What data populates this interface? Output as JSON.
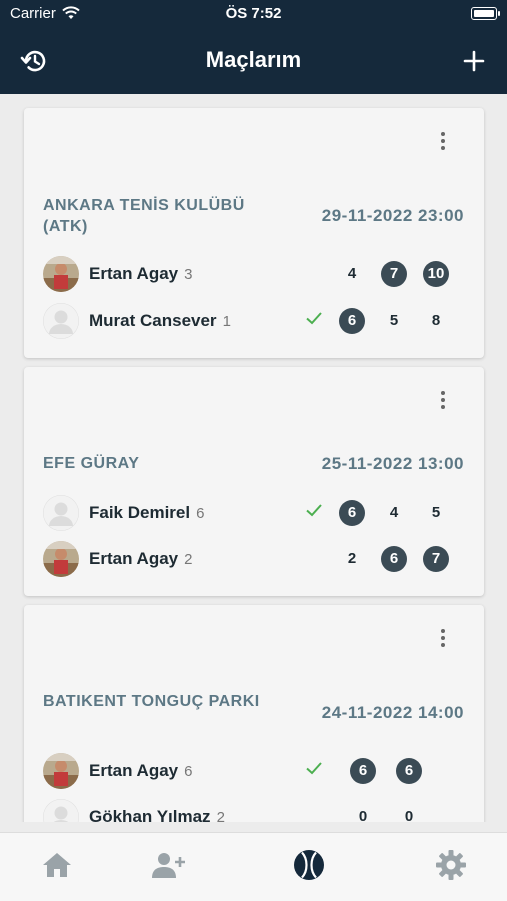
{
  "status_bar": {
    "carrier": "Carrier",
    "time": "ÖS 7:52"
  },
  "header": {
    "title": "Maçlarım",
    "left_icon": "history-icon",
    "right_icon": "plus-icon"
  },
  "matches": [
    {
      "club": "ANKARA TENİS KULÜBÜ (ATK)",
      "date": "29-11-2022 23:00",
      "players": [
        {
          "name": "Ertan Agay",
          "rank": "3",
          "winner": false,
          "avatar": "photo",
          "scores": [
            {
              "value": "4",
              "won": false
            },
            {
              "value": "7",
              "won": true
            },
            {
              "value": "10",
              "won": true
            }
          ]
        },
        {
          "name": "Murat Cansever",
          "rank": "1",
          "winner": true,
          "avatar": "placeholder",
          "scores": [
            {
              "value": "6",
              "won": true
            },
            {
              "value": "5",
              "won": false
            },
            {
              "value": "8",
              "won": false
            }
          ]
        }
      ]
    },
    {
      "club": "EFE GÜRAY",
      "date": "25-11-2022 13:00",
      "players": [
        {
          "name": "Faik Demirel",
          "rank": "6",
          "winner": true,
          "avatar": "placeholder",
          "scores": [
            {
              "value": "6",
              "won": true
            },
            {
              "value": "4",
              "won": false
            },
            {
              "value": "5",
              "won": false
            }
          ]
        },
        {
          "name": "Ertan Agay",
          "rank": "2",
          "winner": false,
          "avatar": "photo",
          "scores": [
            {
              "value": "2",
              "won": false
            },
            {
              "value": "6",
              "won": true
            },
            {
              "value": "7",
              "won": true
            }
          ]
        }
      ]
    },
    {
      "club": "BATIKENT TONGUÇ PARKI",
      "date": "24-11-2022 14:00",
      "players": [
        {
          "name": "Ertan Agay",
          "rank": "6",
          "winner": true,
          "avatar": "photo",
          "scores": [
            {
              "value": "6",
              "won": true
            },
            {
              "value": "6",
              "won": true
            }
          ]
        },
        {
          "name": "Gökhan Yılmaz",
          "rank": "2",
          "winner": false,
          "avatar": "placeholder",
          "scores": [
            {
              "value": "0",
              "won": false
            },
            {
              "value": "0",
              "won": false
            }
          ]
        }
      ]
    }
  ],
  "tabs": [
    {
      "name": "home-icon",
      "active": false
    },
    {
      "name": "add-user-icon",
      "active": false
    },
    {
      "name": "tennis-ball-icon",
      "active": true
    },
    {
      "name": "gear-icon",
      "active": false
    }
  ],
  "colors": {
    "header": "#15293b",
    "accent_text": "#5d7885",
    "score_badge": "#3b4b55",
    "check": "#4caf50",
    "tab_inactive": "#9aa3a8",
    "tab_active": "#15293b"
  }
}
